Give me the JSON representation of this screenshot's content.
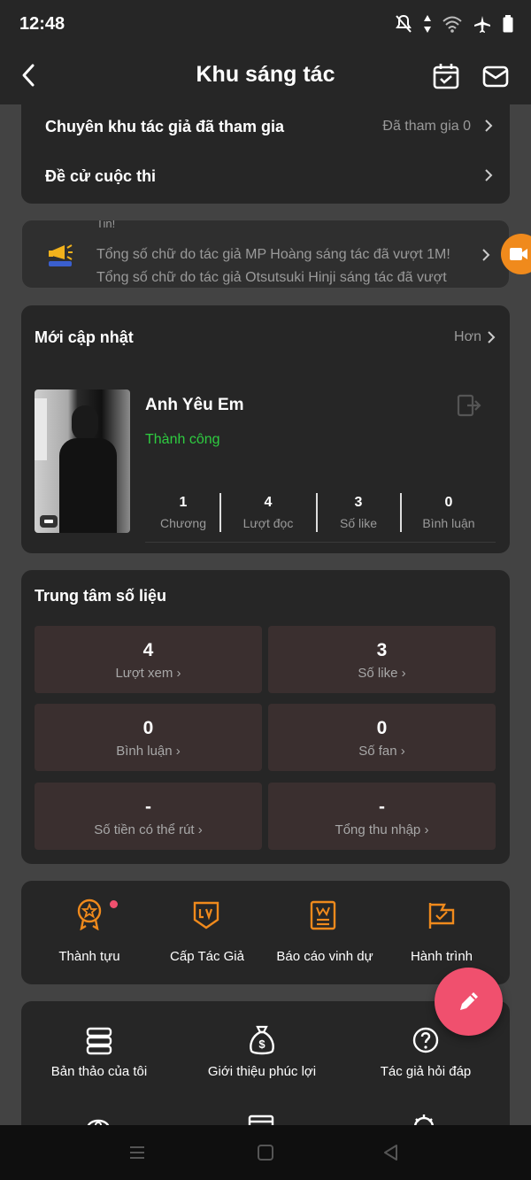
{
  "status": {
    "time": "12:48"
  },
  "header": {
    "title": "Khu sáng tác"
  },
  "top_card": {
    "row1_label": "Chuyên khu tác giả đã tham gia",
    "row1_value": "Đã tham gia 0",
    "row2_label": "Đề cử cuộc thi"
  },
  "notice": {
    "small_label": "Tin!",
    "line1": "Tổng số chữ do tác giả MP Hoàng sáng tác đã vượt 1M!",
    "line2": "Tổng số chữ do tác giả Otsutsuki Hinji sáng tác đã vượt"
  },
  "updates": {
    "title": "Mới cập nhật",
    "more": "Hơn",
    "book_title": "Anh Yêu Em",
    "book_status": "Thành công",
    "stats": [
      {
        "value": "1",
        "label": "Chương"
      },
      {
        "value": "4",
        "label": "Lượt đọc"
      },
      {
        "value": "3",
        "label": "Số like"
      },
      {
        "value": "0",
        "label": "Bình luận"
      }
    ]
  },
  "data_center": {
    "title": "Trung tâm số liệu",
    "boxes": [
      {
        "value": "4",
        "label": "Lượt xem"
      },
      {
        "value": "3",
        "label": "Số like"
      },
      {
        "value": "0",
        "label": "Bình luận"
      },
      {
        "value": "0",
        "label": "Số fan"
      },
      {
        "value": "-",
        "label": "Số tiền có thể rút"
      },
      {
        "value": "-",
        "label": "Tổng thu nhập"
      }
    ]
  },
  "tools": [
    {
      "label": "Thành tựu",
      "icon": "medal-icon"
    },
    {
      "label": "Cấp Tác Giả",
      "icon": "level-badge-icon"
    },
    {
      "label": "Báo cáo vinh dự",
      "icon": "honor-report-icon"
    },
    {
      "label": "Hành trình",
      "icon": "flag-icon"
    }
  ],
  "menu": [
    {
      "label": "Bản thảo của tôi",
      "icon": "drafts-icon"
    },
    {
      "label": "Giới thiệu phúc lợi",
      "icon": "money-bag-icon"
    },
    {
      "label": "Tác giả hỏi đáp",
      "icon": "question-icon"
    }
  ],
  "colors": {
    "accent": "#f08a1c",
    "success": "#2ecc40",
    "fab": "#f0506e",
    "stat_box": "#3a2f2f"
  }
}
